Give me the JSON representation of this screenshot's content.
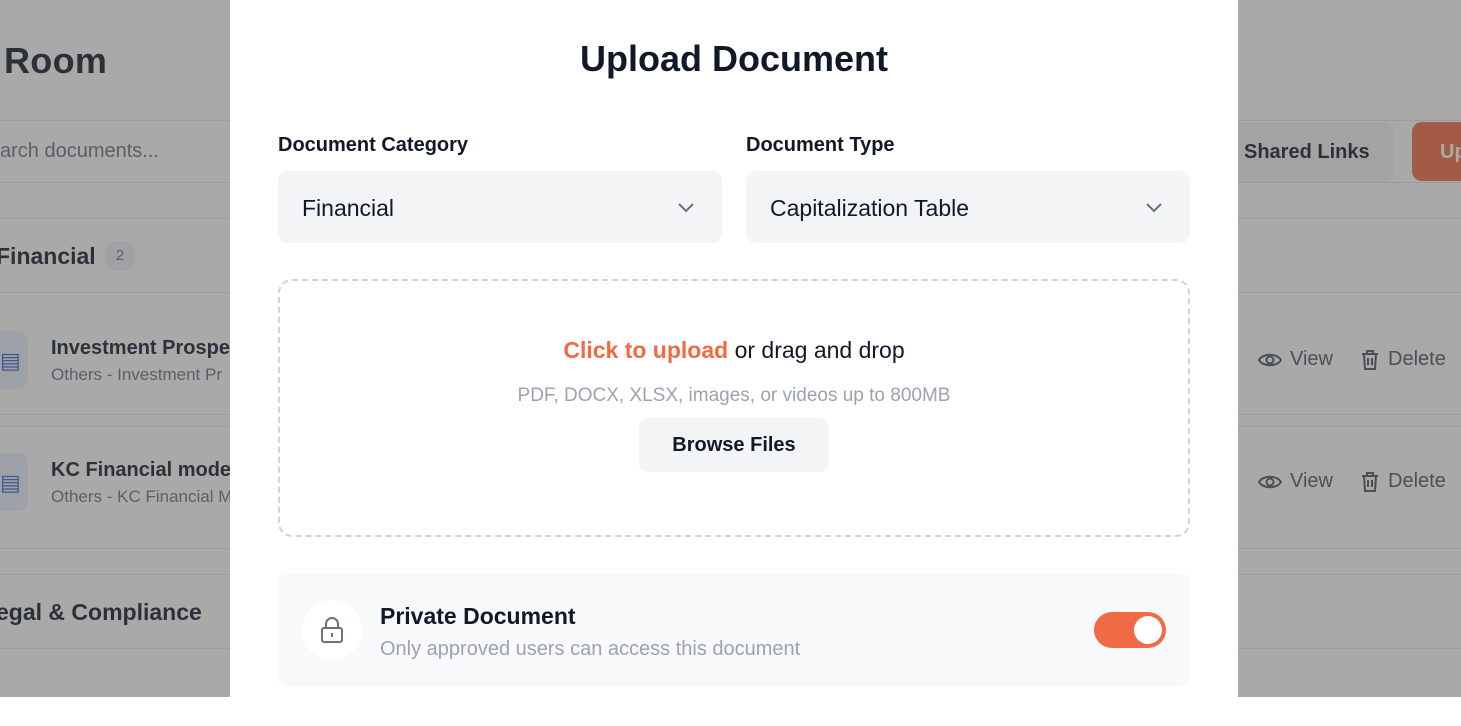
{
  "background": {
    "page_title": "Room",
    "search_placeholder": "arch documents...",
    "shared_links_label": "Shared Links",
    "upload_label": "Up",
    "sections": [
      {
        "name": "Financial",
        "count": "2",
        "documents": [
          {
            "title": "Investment Prospe",
            "subtitle": "Others - Investment Pr"
          },
          {
            "title": "KC Financial model",
            "subtitle": "Others - KC Financial M"
          }
        ]
      },
      {
        "name": "egal & Compliance"
      }
    ],
    "view_label": "View",
    "delete_label": "Delete"
  },
  "modal": {
    "title": "Upload Document",
    "category": {
      "label": "Document Category",
      "value": "Financial"
    },
    "type": {
      "label": "Document Type",
      "value": "Capitalization Table"
    },
    "dropzone": {
      "link_text": "Click to upload",
      "rest_text": " or drag and drop",
      "hint": "PDF, DOCX, XLSX, images, or videos up to 800MB",
      "browse_label": "Browse Files"
    },
    "private": {
      "title": "Private Document",
      "subtitle": "Only approved users can access this document",
      "enabled": true
    }
  },
  "colors": {
    "accent": "#f06a43"
  }
}
